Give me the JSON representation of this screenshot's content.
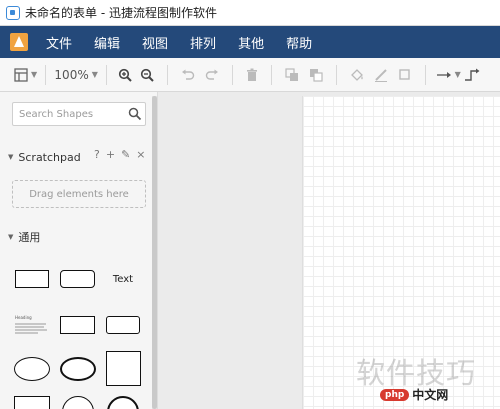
{
  "window": {
    "title": "未命名的表单 - 迅捷流程图制作软件"
  },
  "menu": {
    "items": [
      "文件",
      "编辑",
      "视图",
      "排列",
      "其他",
      "帮助"
    ]
  },
  "toolbar": {
    "zoom": "100%"
  },
  "sidebar": {
    "search_placeholder": "Search Shapes",
    "scratchpad": {
      "title": "Scratchpad",
      "tools": [
        "?",
        "+",
        "✎",
        "×"
      ],
      "drop_hint": "Drag elements here"
    },
    "general": {
      "title": "通用",
      "text_shape_label": "Text",
      "heading_shape_label": "Heading"
    }
  },
  "watermark": {
    "text": "软件技巧",
    "badge_php": "php",
    "badge_cn": "中文网"
  }
}
